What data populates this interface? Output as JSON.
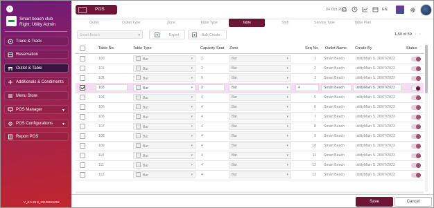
{
  "sidebar": {
    "brand_name": "Smart beach club",
    "brand_role": "Right: Utility Admin",
    "version": "V_0.0.29 8_23108041052",
    "items": [
      {
        "label": "Trace & Track",
        "icon": "trace-icon"
      },
      {
        "label": "Reservation",
        "icon": "reservation-icon"
      },
      {
        "label": "Outlet & Table",
        "icon": "outlet-icon",
        "active": true
      },
      {
        "label": "Additionals & Condiments",
        "icon": "additionals-icon"
      },
      {
        "label": "Menu Store",
        "icon": "menu-store-icon"
      },
      {
        "label": "POS Manager",
        "icon": "pos-manager-icon",
        "expandable": true
      },
      {
        "label": "POS Configurations",
        "icon": "pos-config-icon",
        "expandable": true
      },
      {
        "label": "Report POS",
        "icon": "report-icon"
      }
    ]
  },
  "header": {
    "app_tab": "POS",
    "date": "04 Oct 2023",
    "language": "EN",
    "icons": [
      "bell-icon",
      "clock-icon",
      "chart-icon",
      "calendar-icon"
    ]
  },
  "subtabs": [
    "Outlet",
    "Outlet Type",
    "Zone",
    "Table Type",
    "Table",
    "Shift",
    "Service Type",
    "Table Plan"
  ],
  "active_subtab": "Table",
  "toolbar": {
    "outlet_placeholder": "Smart Beach",
    "export_label": "Export",
    "bulk_create_label": "Bulk Create",
    "pager_text": "1-50 of 59"
  },
  "columns": [
    "Table No",
    "Table Type",
    "Capacity Seat",
    "Zone",
    "Seq No.",
    "Outlet Name",
    "Create By",
    "Status"
  ],
  "rows": [
    {
      "table_no": "100",
      "table_type": "Bar",
      "capacity": "2",
      "zone": "Bar",
      "seq": "1",
      "outlet": "Smart Beach",
      "create_by": "utilityMain S. 26/07/2023",
      "active": true,
      "selected": false
    },
    {
      "table_no": "101",
      "table_type": "Bar",
      "capacity": "3",
      "zone": "Bar",
      "seq": "2",
      "outlet": "Smart Beach",
      "create_by": "utilityMain S. 26/07/2023",
      "active": true,
      "selected": false
    },
    {
      "table_no": "102",
      "table_type": "Bar",
      "capacity": "9",
      "zone": "Bar",
      "seq": "3",
      "outlet": "Smart Beach",
      "create_by": "utilityMain S. 26/07/2023",
      "active": true,
      "selected": false
    },
    {
      "table_no": "103",
      "table_type": "Bar",
      "capacity": "3",
      "zone": "Bar",
      "seq": "4",
      "outlet": "Smart Beach",
      "create_by": "utilityMain S. 26/07/2023",
      "active": true,
      "selected": true
    },
    {
      "table_no": "104",
      "table_type": "Bar",
      "capacity": "4",
      "zone": "Bar",
      "seq": "5",
      "outlet": "Smart Beach",
      "create_by": "utilityMain S. 26/07/2023",
      "active": true,
      "selected": false
    },
    {
      "table_no": "105",
      "table_type": "Bar",
      "capacity": "4",
      "zone": "Bar",
      "seq": "6",
      "outlet": "Smart Beach",
      "create_by": "utilityMain S. 26/07/2023",
      "active": true,
      "selected": false
    },
    {
      "table_no": "106",
      "table_type": "Bar",
      "capacity": "4",
      "zone": "Bar",
      "seq": "7",
      "outlet": "Smart Beach",
      "create_by": "utilityMain S. 26/07/2023",
      "active": true,
      "selected": false
    },
    {
      "table_no": "107",
      "table_type": "Bar",
      "capacity": "4",
      "zone": "Bar",
      "seq": "8",
      "outlet": "Smart Beach",
      "create_by": "utilityMain S. 26/07/2023",
      "active": true,
      "selected": false
    },
    {
      "table_no": "108",
      "table_type": "Bar",
      "capacity": "4",
      "zone": "Bar",
      "seq": "9",
      "outlet": "Smart Beach",
      "create_by": "utilityMain S. 26/07/2023",
      "active": true,
      "selected": false
    },
    {
      "table_no": "109",
      "table_type": "Bar",
      "capacity": "4",
      "zone": "Bar",
      "seq": "10",
      "outlet": "Smart Beach",
      "create_by": "utilityMain S. 26/07/2023",
      "active": true,
      "selected": false
    },
    {
      "table_no": "110",
      "table_type": "Bar",
      "capacity": "4",
      "zone": "Bar",
      "seq": "11",
      "outlet": "Smart Beach",
      "create_by": "utilityMain S. 26/07/2023",
      "active": true,
      "selected": false
    },
    {
      "table_no": "111",
      "table_type": "Bar",
      "capacity": "4",
      "zone": "Bar",
      "seq": "12",
      "outlet": "Smart Beach",
      "create_by": "utilityMain S. 26/07/2023",
      "active": true,
      "selected": false
    },
    {
      "table_no": "112",
      "table_type": "Bar",
      "capacity": "4",
      "zone": "Bar",
      "seq": "13",
      "outlet": "Smart Beach",
      "create_by": "utilityMain S. 26/07/2023",
      "active": true,
      "selected": false
    }
  ],
  "footer": {
    "save_label": "Save",
    "cancel_label": "Cancel"
  },
  "colors": {
    "brand": "#6d1535",
    "sidebar_top": "#6e1a7a",
    "sidebar_bottom": "#c0262e",
    "selected_row": "#f3ddf0"
  }
}
